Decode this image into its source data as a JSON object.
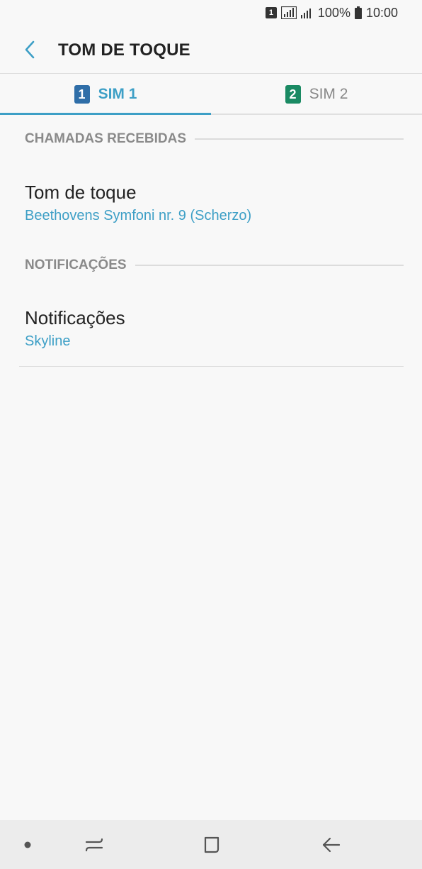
{
  "status_bar": {
    "sim_badge": "1",
    "battery": "100%",
    "time": "10:00"
  },
  "header": {
    "title": "TOM DE TOQUE"
  },
  "tabs": [
    {
      "badge": "1",
      "label": "SIM 1",
      "active": true,
      "color": "#2f6ea8"
    },
    {
      "badge": "2",
      "label": "SIM 2",
      "active": false,
      "color": "#1a8a63"
    }
  ],
  "sections": {
    "received": {
      "title": "CHAMADAS RECEBIDAS",
      "item_title": "Tom de toque",
      "item_value": "Beethovens Symfoni nr. 9 (Scherzo)"
    },
    "notifications": {
      "title": "NOTIFICAÇÕES",
      "item_title": "Notificações",
      "item_value": "Skyline"
    }
  },
  "colors": {
    "accent": "#3d9fc6",
    "background": "#f8f8f8",
    "nav_background": "#ececec"
  },
  "icons": {
    "back": "chevron-left-icon",
    "nav_dot": "dot-icon",
    "nav_recents": "recents-icon",
    "nav_home": "home-icon",
    "nav_back": "arrow-left-icon"
  }
}
